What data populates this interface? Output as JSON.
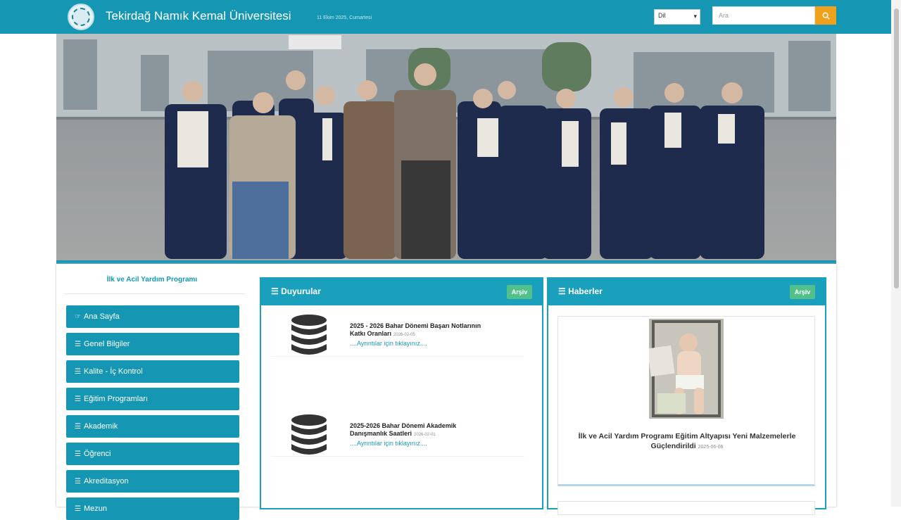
{
  "header": {
    "site_title": "Tekirdağ Namık Kemal Üniversitesi",
    "date_text": "11 Ekim 2025, Cumartesi",
    "language_select": "Dil",
    "search_placeholder": "Ara"
  },
  "hero": {
    "slide_count": 3,
    "active_slide": 1
  },
  "sidebar": {
    "title": "İlk ve Acil Yardım Programı",
    "items": [
      {
        "label": "Ana Sayfa",
        "icon": "hand-point-icon",
        "glyph": "☞"
      },
      {
        "label": "Genel Bilgiler",
        "icon": "list-icon",
        "glyph": "☰"
      },
      {
        "label": "Kalite - İç Kontrol",
        "icon": "list-icon",
        "glyph": "☰"
      },
      {
        "label": "Eğitim Programları",
        "icon": "list-icon",
        "glyph": "☰"
      },
      {
        "label": "Akademik",
        "icon": "list-icon",
        "glyph": "☰"
      },
      {
        "label": "Öğrenci",
        "icon": "list-icon",
        "glyph": "☰"
      },
      {
        "label": "Akreditasyon",
        "icon": "list-icon",
        "glyph": "☰"
      },
      {
        "label": "Mezun",
        "icon": "list-icon",
        "glyph": "☰"
      }
    ]
  },
  "announcements": {
    "title": "Duyurular",
    "archive_label": "Arşiv",
    "items": [
      {
        "title": "2025 - 2026 Bahar Dönemi Başarı Notlarının Katkı Oranları",
        "date": "2026-02-05",
        "link": "....Ayrıntılar için tıklayınız....",
        "icon": "database-icon"
      },
      {
        "title": "2025-2026 Bahar Dönemi Akademik Danışmanlık Saatleri",
        "date": "2026-02-01",
        "link": "....Ayrıntılar için tıklayınız....",
        "icon": "database-icon"
      }
    ]
  },
  "news": {
    "title": "Haberler",
    "archive_label": "Arşiv",
    "items": [
      {
        "title": "İlk ve Acil Yardım Programı Eğitim Altyapısı Yeni Malzemelerle Güçlendirildi",
        "date": "2025-06-06"
      }
    ]
  },
  "colors": {
    "primary": "#1597b3",
    "search_button": "#f0a11c",
    "archive_button": "#52c08a"
  }
}
